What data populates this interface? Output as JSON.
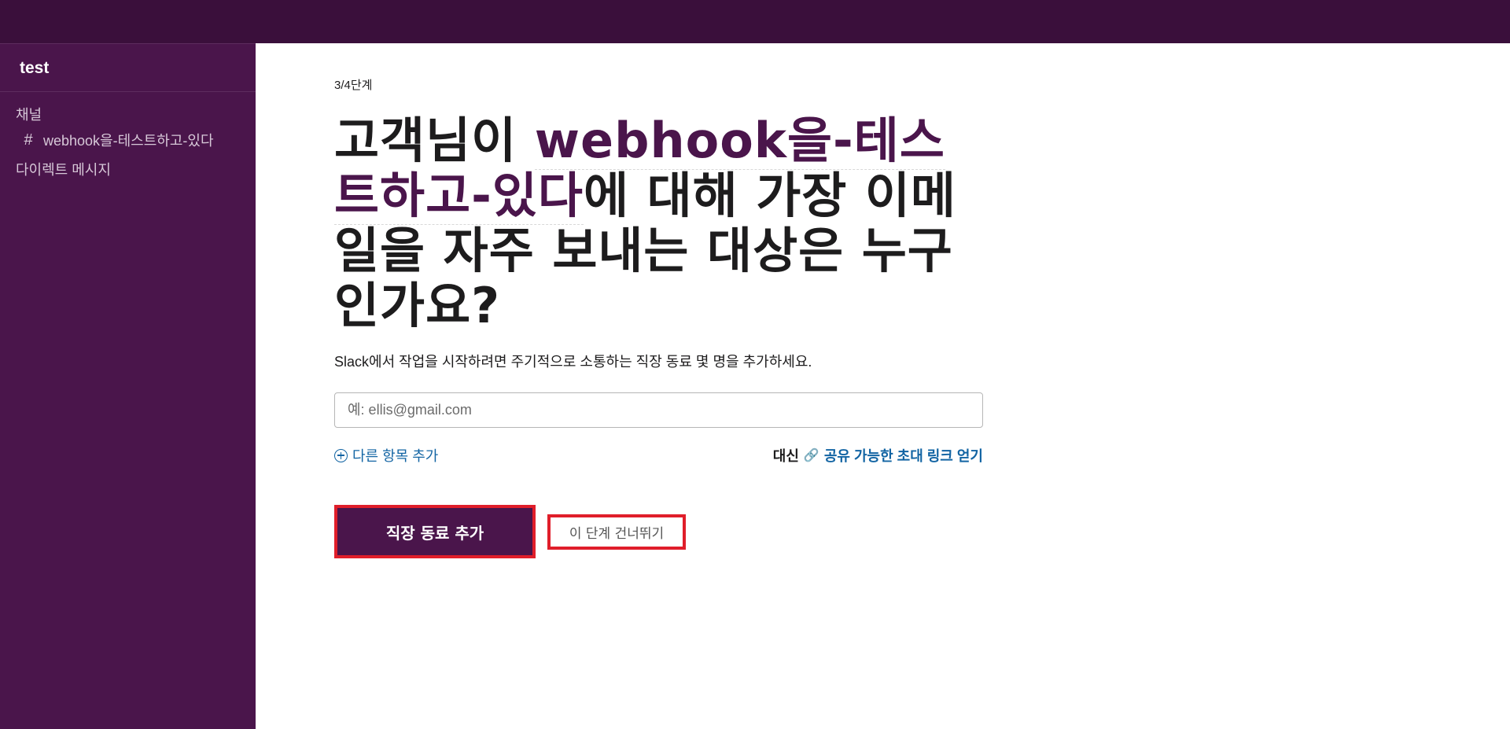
{
  "sidebar": {
    "workspace": "test",
    "channels_label": "채널",
    "channels": [
      {
        "name": "webhook을-테스트하고-있다"
      }
    ],
    "dm_label": "다이렉트 메시지"
  },
  "main": {
    "step": "3/4단계",
    "headline_prefix": "고객님이 ",
    "headline_channel": "webhook을-테스트하고-있다",
    "headline_suffix": "에 대해 가장 이메일을 자주 보내는 대상은 누구인가요?",
    "subtitle": "Slack에서 작업을 시작하려면 주기적으로 소통하는 직장 동료 몇 명을 추가하세요.",
    "email_placeholder": "예: ellis@gmail.com",
    "add_another": "다른 항목 추가",
    "instead_label": "대신",
    "share_link": "공유 가능한 초대 링크 얻기",
    "primary_button": "직장 동료 추가",
    "skip_button": "이 단계 건너뛰기"
  },
  "colors": {
    "sidebar_bg": "#4a154b",
    "topbar_bg": "#3a0f3b",
    "link": "#1264a3",
    "highlight_border": "#e01e2a"
  }
}
